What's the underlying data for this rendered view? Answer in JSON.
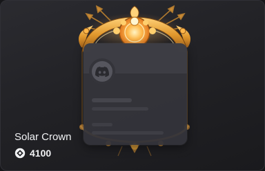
{
  "item": {
    "name": "Solar Crown",
    "price": "4100",
    "price_icon": "orb-currency-icon",
    "decoration_icon": "solar-crown-frame",
    "avatar_icon": "discord-logo-icon"
  },
  "colors": {
    "background": "#161619",
    "card": "#222226",
    "panel": "#34343a",
    "gold": "#e8a93a",
    "sun": "#ffb74a",
    "text": "#f2f3f5"
  }
}
